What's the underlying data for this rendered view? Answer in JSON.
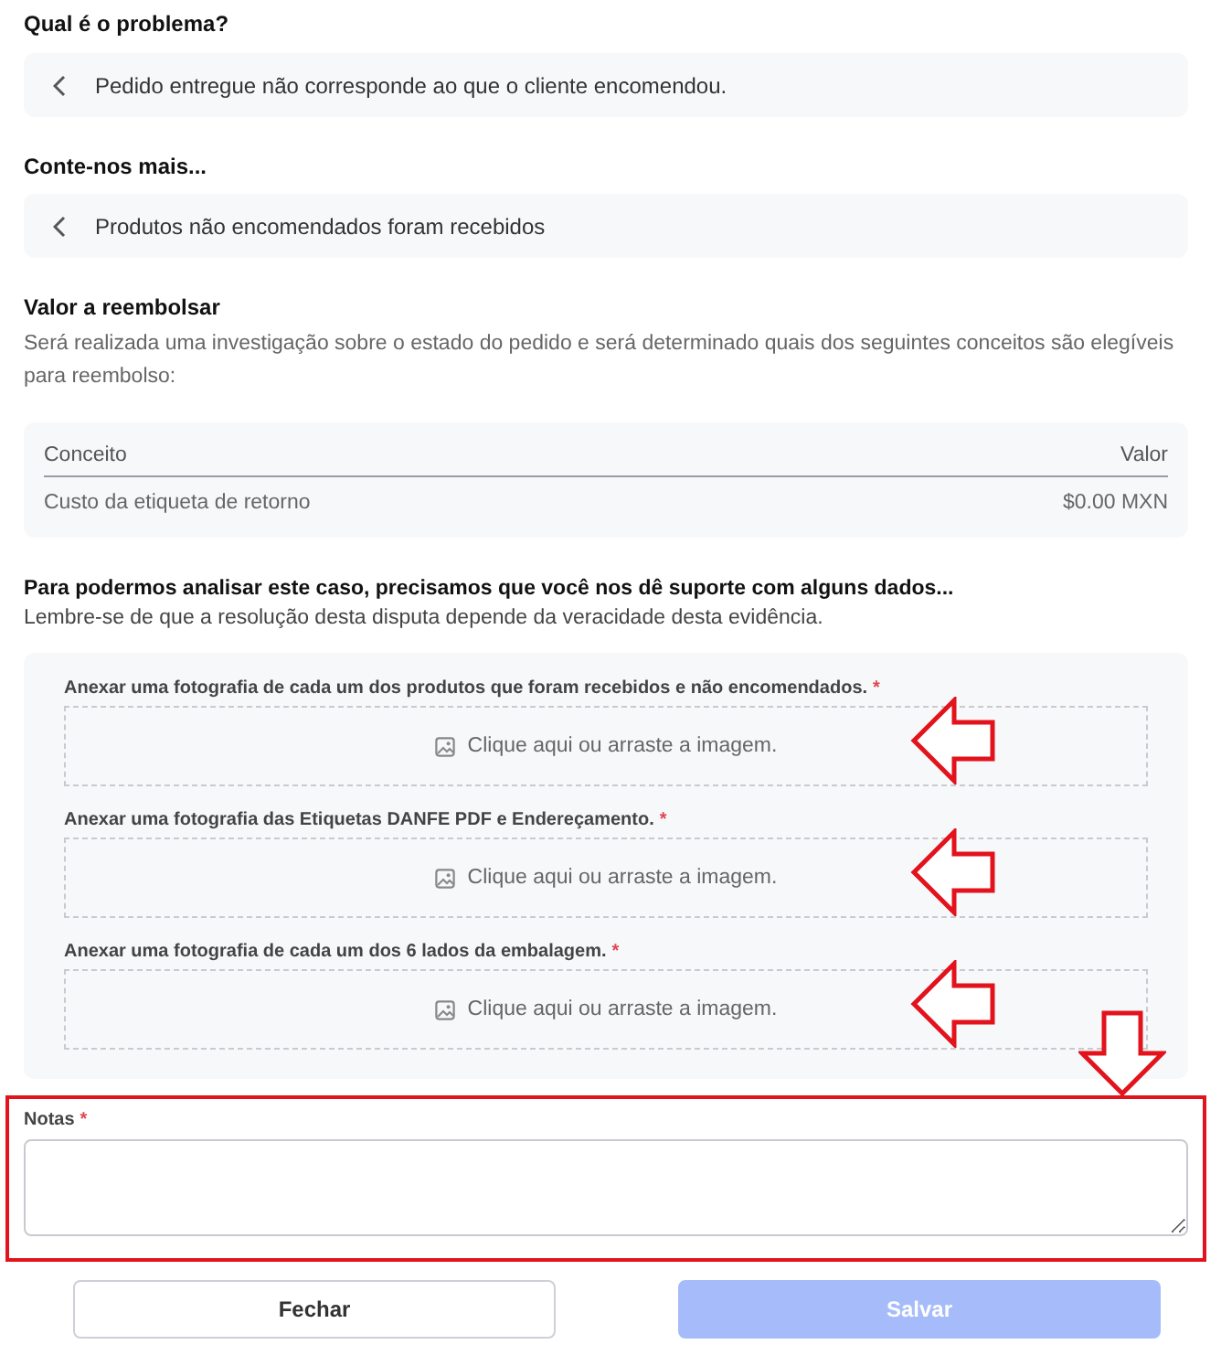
{
  "problem": {
    "heading": "Qual é o problema?",
    "value": "Pedido entregue não corresponde ao que o cliente encomendou."
  },
  "details": {
    "heading": "Conte-nos mais...",
    "value": "Produtos não encomendados foram recebidos"
  },
  "refund": {
    "heading": "Valor a reembolsar",
    "description": "Será realizada uma investigação sobre o estado do pedido e será determinado quais dos seguintes conceitos são elegíveis para reembolso:",
    "table": {
      "columns": [
        "Conceito",
        "Valor"
      ],
      "rows": [
        [
          "Custo da etiqueta de retorno",
          "$0.00 MXN"
        ]
      ]
    }
  },
  "evidence": {
    "heading": "Para podermos analisar este caso, precisamos que você nos dê suporte com alguns dados...",
    "note": "Lembre-se de que a resolução desta disputa depende da veracidade desta evidência.",
    "uploads": [
      {
        "label": "Anexar uma fotografia de cada um dos produtos que foram recebidos e não encomendados.",
        "required_mark": "*",
        "placeholder": "Clique aqui ou arraste a imagem."
      },
      {
        "label": "Anexar uma fotografia das Etiquetas DANFE PDF e Endereçamento.",
        "required_mark": "*",
        "placeholder": "Clique aqui ou arraste a imagem."
      },
      {
        "label": "Anexar uma fotografia de cada um dos 6 lados da embalagem.",
        "required_mark": "*",
        "placeholder": "Clique aqui ou arraste a imagem."
      }
    ]
  },
  "notes": {
    "label": "Notas",
    "required_mark": "*"
  },
  "buttons": [
    {
      "label": "Fechar",
      "kind": "secondary",
      "disabled": false
    },
    {
      "label": "Salvar",
      "kind": "primary",
      "disabled": true
    }
  ]
}
